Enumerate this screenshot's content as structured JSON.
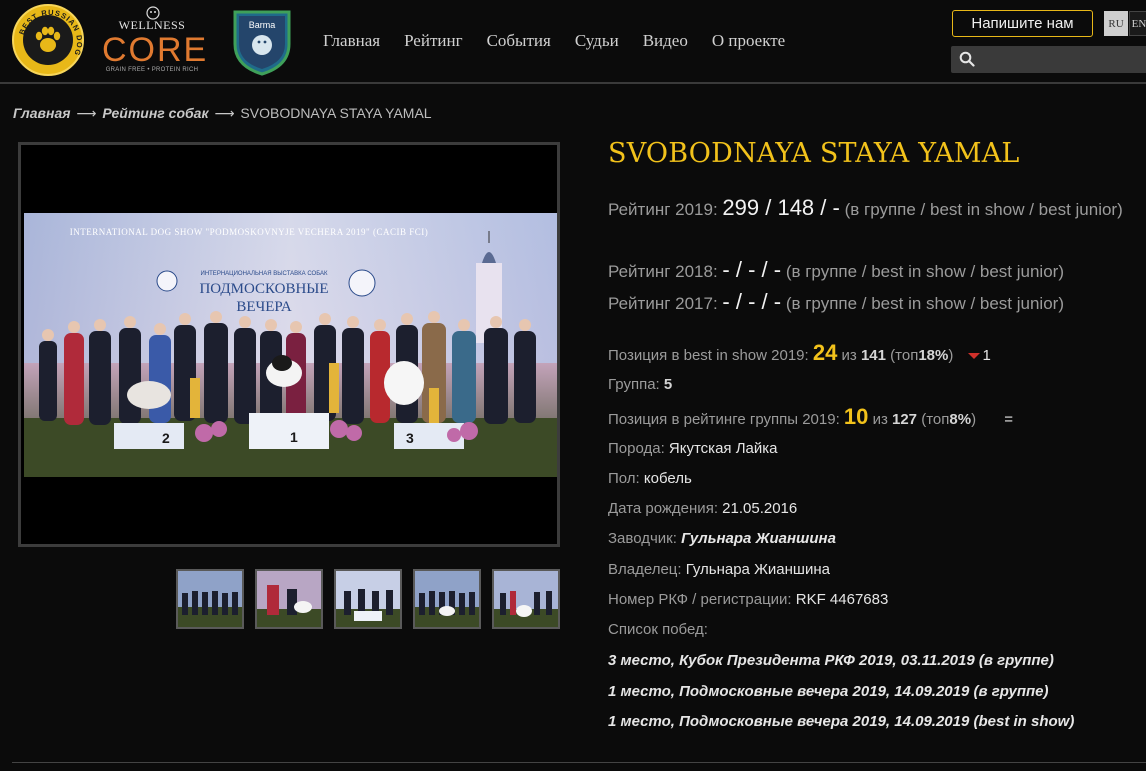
{
  "header": {
    "nav": [
      "Главная",
      "Рейтинг",
      "События",
      "Судьи",
      "Видео",
      "О проекте"
    ],
    "contact_label": "Напишите нам",
    "lang_ru": "RU",
    "lang_en": "EN",
    "search_placeholder": "",
    "logos": {
      "brd_text": "BEST RUSSIAN DOG",
      "wellness": "WELLNESS",
      "core": "CORE",
      "core_sub": "GRAIN FREE • PROTEIN RICH",
      "shield": "Barma"
    }
  },
  "breadcrumb": {
    "home": "Главная",
    "sep": "⟶",
    "rating": "Рейтинг собак",
    "current": "SVOBODNAYA STAYA YAMAL"
  },
  "photo": {
    "banner_en": "INTERNATIONAL DOG SHOW \"PODMOSKOVNYJE VECHERA 2019\" (CACIB FCI)",
    "banner_ru1": "ИНТЕРНАЦИОНАЛЬНАЯ ВЫСТАВКА СОБАК",
    "banner_ru2": "ПОДМОСКОВНЫЕ",
    "banner_ru3": "ВЕЧЕРА",
    "podium": [
      "2",
      "1",
      "3"
    ]
  },
  "dog": {
    "title": "SVOBODNAYA STAYA YAMAL",
    "ratings": [
      {
        "label": "Рейтинг 2019:",
        "value": "299 / 148 / -",
        "suffix": "(в группе / best in show / best junior)"
      },
      {
        "label": "Рейтинг 2018:",
        "value": "- / - / -",
        "suffix": "(в группе / best in show / best junior)"
      },
      {
        "label": "Рейтинг 2017:",
        "value": "- / - / -",
        "suffix": "(в группе / best in show / best junior)"
      }
    ],
    "bis_position": {
      "label": "Позиция в best in show 2019:",
      "pos": "24",
      "of": "из",
      "total": "141",
      "top_open": "(топ",
      "top": "18%",
      "top_close": ")",
      "change": "1"
    },
    "group": {
      "label": "Группа:",
      "value": "5"
    },
    "group_position": {
      "label": "Позиция в рейтинге группы 2019:",
      "pos": "10",
      "of": "из",
      "total": "127",
      "top_open": "(топ",
      "top": "8%",
      "top_close": ")",
      "change": "="
    },
    "breed": {
      "label": "Порода:",
      "value": "Якутская Лайка"
    },
    "sex": {
      "label": "Пол:",
      "value": "кобель"
    },
    "birth": {
      "label": "Дата рождения:",
      "value": "21.05.2016"
    },
    "breeder": {
      "label": "Заводчик:",
      "value": "Гульнара Жианшина"
    },
    "owner": {
      "label": "Владелец:",
      "value": "Гульнара Жианшина"
    },
    "rkf": {
      "label": "Номер РКФ / регистрации:",
      "value": "RKF 4467683"
    },
    "wins_label": "Список побед:",
    "wins": [
      "3 место, Кубок Президента РКФ 2019, 03.11.2019 (в группе)",
      "1 место, Подмосковные вечера 2019, 14.09.2019 (в группе)",
      "1 место, Подмосковные вечера 2019, 14.09.2019 (best in show)"
    ]
  },
  "colors": {
    "accent": "#f2c21b",
    "background": "#0b0b0b",
    "down": "#d0302a"
  }
}
